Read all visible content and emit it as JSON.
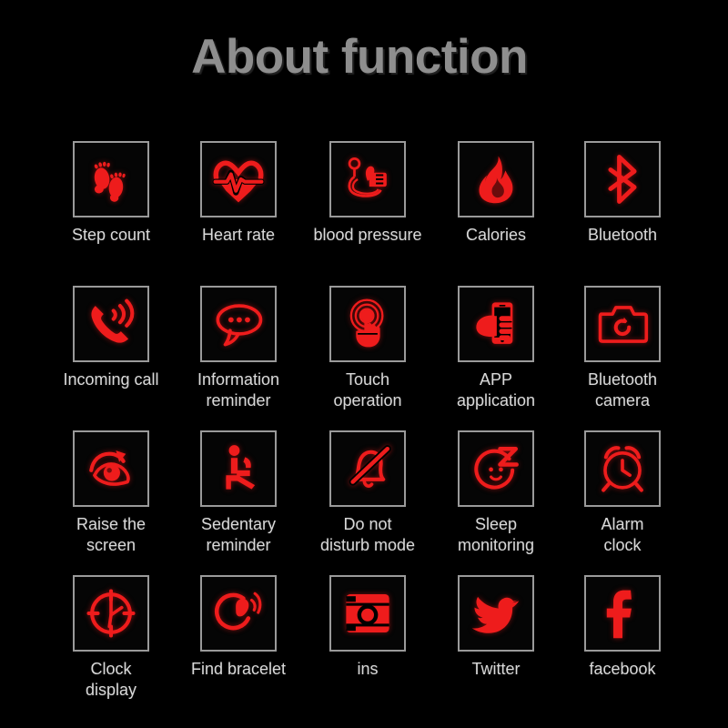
{
  "page": {
    "title": "About function",
    "background_color": "#000000",
    "title_color": "#8e8e8e",
    "label_color": "#d9d9d9",
    "icon_color": "#ee1c1c",
    "icon_box_border_color": "#9a9a9a",
    "columns": 5,
    "rows": 4
  },
  "rows": [
    {
      "items": [
        {
          "icon": "footprints-icon",
          "label": "Step count"
        },
        {
          "icon": "heart-pulse-icon",
          "label": "Heart rate"
        },
        {
          "icon": "blood-pressure-monitor-icon",
          "label": "blood pressure"
        },
        {
          "icon": "flame-icon",
          "label": "Calories"
        },
        {
          "icon": "bluetooth-icon",
          "label": "Bluetooth"
        }
      ]
    },
    {
      "items": [
        {
          "icon": "phone-ringing-icon",
          "label": "Incoming call"
        },
        {
          "icon": "speech-bubble-icon",
          "label": "Information\nreminder"
        },
        {
          "icon": "touch-hand-icon",
          "label": "Touch\noperation"
        },
        {
          "icon": "hand-holding-phone-icon",
          "label": "APP\napplication"
        },
        {
          "icon": "camera-icon",
          "label": "Bluetooth\ncamera"
        }
      ]
    },
    {
      "items": [
        {
          "icon": "eye-rotate-icon",
          "label": "Raise the\nscreen"
        },
        {
          "icon": "sitting-person-icon",
          "label": "Sedentary\nreminder"
        },
        {
          "icon": "bell-slash-icon",
          "label": "Do not\ndisturb mode"
        },
        {
          "icon": "sleep-face-z-icon",
          "label": "Sleep\nmonitoring"
        },
        {
          "icon": "alarm-clock-icon",
          "label": "Alarm\nclock"
        }
      ]
    },
    {
      "items": [
        {
          "icon": "clock-dial-icon",
          "label": "Clock\ndisplay"
        },
        {
          "icon": "bracelet-vibrate-icon",
          "label": "Find bracelet"
        },
        {
          "icon": "instagram-icon",
          "label": "ins"
        },
        {
          "icon": "twitter-bird-icon",
          "label": "Twitter"
        },
        {
          "icon": "facebook-f-icon",
          "label": "facebook"
        }
      ]
    }
  ]
}
